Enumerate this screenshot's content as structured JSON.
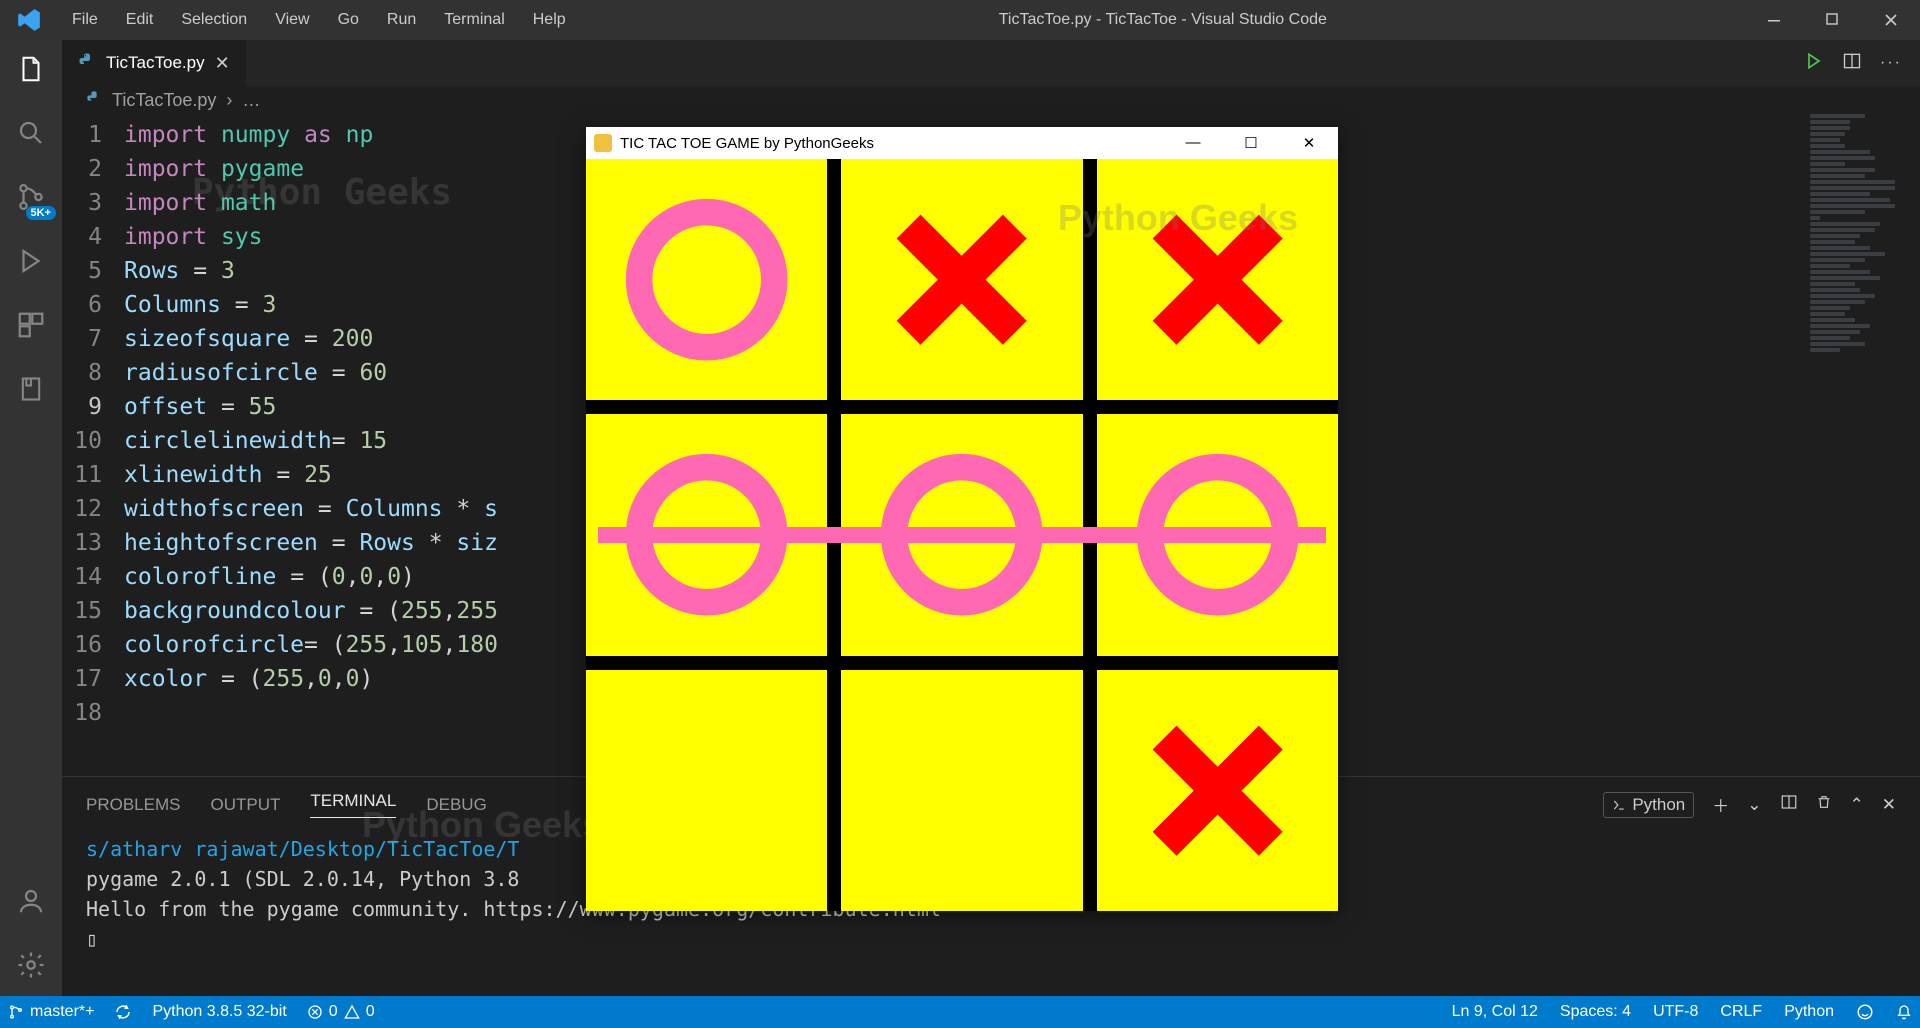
{
  "window": {
    "title": "TicTacToe.py - TicTacToe - Visual Studio Code"
  },
  "menu": {
    "file": "File",
    "edit": "Edit",
    "selection": "Selection",
    "view": "View",
    "go": "Go",
    "run": "Run",
    "terminal": "Terminal",
    "help": "Help"
  },
  "activity": {
    "badge": "5K+"
  },
  "tab": {
    "filename": "TicTacToe.py"
  },
  "breadcrumb": {
    "file": "TicTacToe.py",
    "more": "…"
  },
  "code": {
    "lines": [
      {
        "n": 1,
        "html": "<span class='kw'>import</span> <span class='mod'>numpy</span> <span class='kw'>as</span> <span class='mod'>np</span>"
      },
      {
        "n": 2,
        "html": "<span class='kw'>import</span> <span class='mod'>pygame</span>"
      },
      {
        "n": 3,
        "html": "<span class='kw'>import</span> <span class='mod'>math</span>"
      },
      {
        "n": 4,
        "html": "<span class='kw'>import</span> <span class='mod'>sys</span>"
      },
      {
        "n": 5,
        "html": "<span class='id'>Rows</span> <span class='op'>=</span> <span class='num'>3</span>"
      },
      {
        "n": 6,
        "html": "<span class='id'>Columns</span> <span class='op'>=</span> <span class='num'>3</span>"
      },
      {
        "n": 7,
        "html": "<span class='id'>sizeofsquare</span> <span class='op'>=</span> <span class='num'>200</span>"
      },
      {
        "n": 8,
        "html": "<span class='id'>radiusofcircle</span> <span class='op'>=</span> <span class='num'>60</span>"
      },
      {
        "n": 9,
        "html": "<span class='id'>offset</span> <span class='op'>=</span> <span class='num'>55</span>"
      },
      {
        "n": 10,
        "html": "<span class='id'>circlelinewidth</span><span class='op'>=</span> <span class='num'>15</span>"
      },
      {
        "n": 11,
        "html": "<span class='id'>xlinewidth</span> <span class='op'>=</span> <span class='num'>25</span>"
      },
      {
        "n": 12,
        "html": "<span class='id'>widthofscreen</span> <span class='op'>=</span> <span class='id'>Columns</span> <span class='op'>*</span> <span class='id'>s</span>"
      },
      {
        "n": 13,
        "html": "<span class='id'>heightofscreen</span> <span class='op'>=</span> <span class='id'>Rows</span> <span class='op'>*</span> <span class='id'>siz</span>"
      },
      {
        "n": 14,
        "html": "<span class='id'>colorofline</span> <span class='op'>=</span> (<span class='num'>0</span>,<span class='num'>0</span>,<span class='num'>0</span>)"
      },
      {
        "n": 15,
        "html": "<span class='id'>backgroundcolour</span> <span class='op'>=</span> (<span class='num'>255</span>,<span class='num'>255</span>"
      },
      {
        "n": 16,
        "html": "<span class='id'>colorofcircle</span><span class='op'>=</span> (<span class='num'>255</span>,<span class='num'>105</span>,<span class='num'>180</span>"
      },
      {
        "n": 17,
        "html": "<span class='id'>xcolor</span> <span class='op'>=</span> (<span class='num'>255</span>,<span class='num'>0</span>,<span class='num'>0</span>)"
      },
      {
        "n": 18,
        "html": ""
      }
    ],
    "current_line": 9
  },
  "panel": {
    "tabs": {
      "problems": "PROBLEMS",
      "output": "OUTPUT",
      "terminal": "TERMINAL",
      "debug": "DEBUG"
    },
    "active": "TERMINAL",
    "shell_label": "Python",
    "output": {
      "path": "s/atharv rajawat/Desktop/TicTacToe/T",
      "line2": "pygame 2.0.1 (SDL 2.0.14, Python 3.8",
      "line3": "Hello from the pygame community. https://www.pygame.org/contribute.html",
      "cursor": "▯"
    }
  },
  "status": {
    "branch": "master*+",
    "interpreter": "Python 3.8.5 32-bit",
    "errors": "0",
    "warnings": "0",
    "position": "Ln 9, Col 12",
    "spaces": "Spaces: 4",
    "encoding": "UTF-8",
    "eol": "CRLF",
    "language": "Python"
  },
  "game": {
    "title": "TIC TAC TOE GAME by PythonGeeks",
    "grid": [
      [
        "O",
        "X",
        "X"
      ],
      [
        "O",
        "O",
        "O"
      ],
      [
        "",
        "",
        "X"
      ]
    ],
    "win_row": 1
  },
  "watermarks": {
    "w1": "Python\nGeeks",
    "w2": "Python\nGeeks",
    "w3": "Python\nGeeks"
  }
}
